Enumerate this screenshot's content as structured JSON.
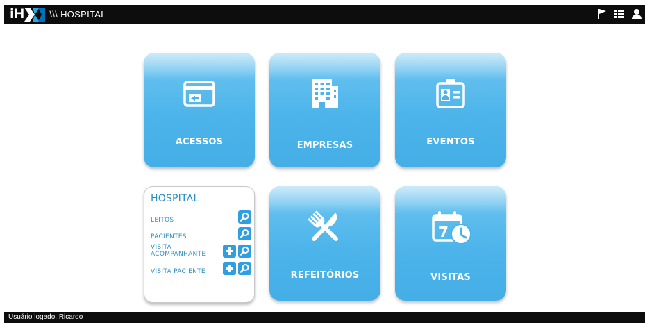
{
  "header": {
    "logo_text": "iH",
    "app_name": "\\\\\\ HOSPITAL",
    "icons": [
      "flag-icon",
      "grid-icon",
      "user-icon"
    ]
  },
  "tiles": {
    "acessos": "ACESSOS",
    "empresas": "EMPRESAS",
    "eventos": "EVENTOS",
    "refeitorios": "REFEITÓRIOS",
    "visitas": "VISITAS"
  },
  "hospital": {
    "title": "HOSPITAL",
    "items": [
      {
        "label": "LEITOS",
        "actions": [
          "search"
        ]
      },
      {
        "label": "PACIENTES",
        "actions": [
          "search"
        ]
      },
      {
        "label_line1": "VISITA",
        "label_line2": "ACOMPANHANTE",
        "actions": [
          "add",
          "search"
        ]
      },
      {
        "label": "VISITA PACIENTE",
        "actions": [
          "add",
          "search"
        ]
      }
    ]
  },
  "footer": {
    "status": "Usuário logado: Ricardo"
  },
  "colors": {
    "tile": "#4cb4ea",
    "tile_top": "#8fd2f2",
    "bar": "#0d0d0d",
    "action_button": "#2f9fe1",
    "hospital_text": "#2a8dc4"
  }
}
